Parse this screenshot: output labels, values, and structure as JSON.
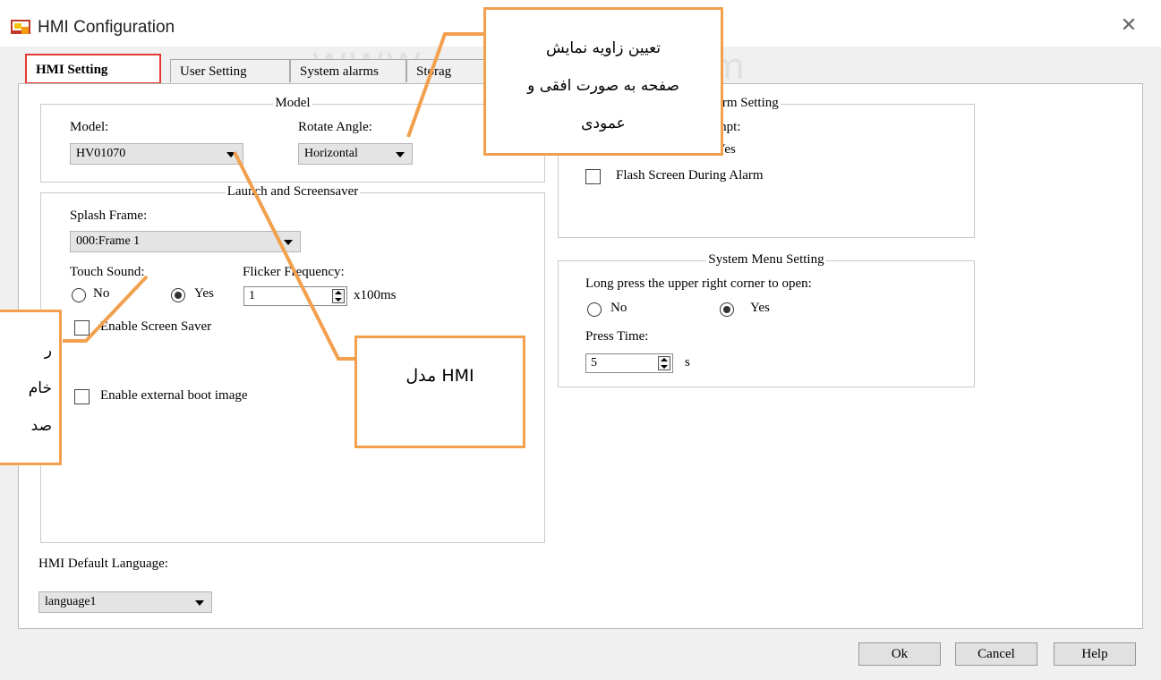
{
  "window": {
    "title": "HMI Configuration",
    "close_icon": "close-icon"
  },
  "tabs": [
    {
      "label": "HMI Setting"
    },
    {
      "label": "User Setting"
    },
    {
      "label": "System alarms"
    },
    {
      "label": "Storag"
    }
  ],
  "watermark": {
    "left": "WWW",
    "right": "com"
  },
  "model_group": {
    "title": "Model",
    "model_label": "Model:",
    "model_value": "HV01070",
    "rotate_label": "Rotate Angle:",
    "rotate_value": "Horizontal"
  },
  "launch_group": {
    "title": "Launch and Screensaver",
    "splash_label": "Splash Frame:",
    "splash_value": "000:Frame 1",
    "touch_label": "Touch Sound:",
    "touch_no": "No",
    "touch_yes": "Yes",
    "touch_selected": "Yes",
    "flicker_label": "Flicker Frequency:",
    "flicker_value": "1",
    "flicker_unit": "x100ms",
    "screensaver_label": "Enable Screen Saver",
    "boot_image_label": "Enable external boot image"
  },
  "alarm_group": {
    "title": "larm Setting",
    "prompt_label": "mpt:",
    "prompt_yes": "Yes",
    "flash_label": "Flash Screen During Alarm"
  },
  "system_menu_group": {
    "title": "System Menu Setting",
    "long_press_label": "Long press the upper right corner to open:",
    "no": "No",
    "yes": "Yes",
    "selected": "Yes",
    "press_time_label": "Press Time:",
    "press_time_value": "5",
    "press_time_unit": "s"
  },
  "language": {
    "label": "HMI Default Language:",
    "value": "language1"
  },
  "buttons": {
    "ok": "Ok",
    "cancel": "Cancel",
    "help": "Help"
  },
  "callouts": {
    "rotate": [
      "تعیین زاویه نمایش",
      "صفحه به صورت افقی و",
      "عمودی"
    ],
    "model": "مدل HMI",
    "left_partial": [
      "ر",
      "خام",
      "صد"
    ]
  },
  "colors": {
    "callout_border": "#f2a04e",
    "active_tab_border": "#e53935"
  }
}
